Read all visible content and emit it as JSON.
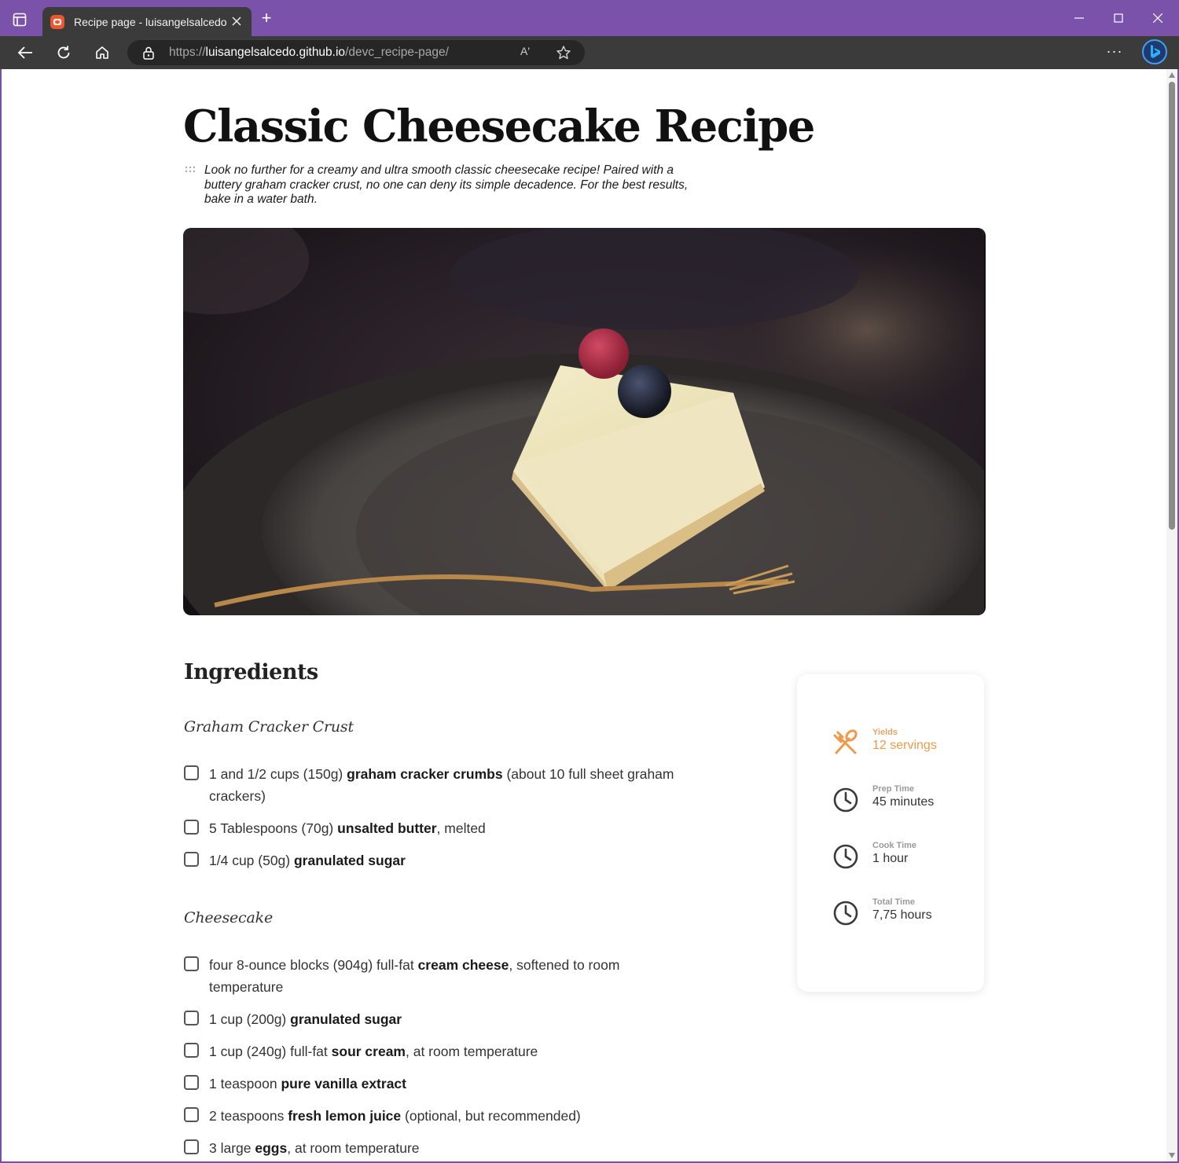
{
  "browser": {
    "tab_title": "Recipe page - luisangelsalcedo",
    "new_tab": "+",
    "url_scheme": "https://",
    "url_host": "luisangelsalcedo.github.io",
    "url_path": "/devc_recipe-page/",
    "read_aloud": "Aʹ",
    "more": "···"
  },
  "page": {
    "title": "Classic Cheesecake Recipe",
    "intro": "Look no further for a creamy and ultra smooth classic cheesecake recipe! Paired with a buttery graham cracker crust, no one can deny its simple decadence. For the best results, bake in a water bath.",
    "ingredients_heading": "Ingredients",
    "crust_heading": "Graham Cracker Crust",
    "cheesecake_heading": "Cheesecake",
    "crust_items": [
      {
        "pre": "1 and 1/2 cups (150g) ",
        "bold": "graham cracker crumbs",
        "post": " (about 10 full sheet graham crackers)"
      },
      {
        "pre": "5 Tablespoons (70g) ",
        "bold": "unsalted butter",
        "post": ", melted"
      },
      {
        "pre": "1/4 cup (50g) ",
        "bold": "granulated sugar",
        "post": ""
      }
    ],
    "cheesecake_items": [
      {
        "pre": "four 8-ounce blocks (904g) full-fat ",
        "bold": "cream cheese",
        "post": ", softened to room temperature"
      },
      {
        "pre": "1 cup (200g) ",
        "bold": "granulated sugar",
        "post": ""
      },
      {
        "pre": "1 cup (240g) full-fat ",
        "bold": "sour cream",
        "post": ", at room temperature"
      },
      {
        "pre": "1 teaspoon ",
        "bold": "pure vanilla extract",
        "post": ""
      },
      {
        "pre": "2 teaspoons ",
        "bold": "fresh lemon juice",
        "post": " (optional, but recommended)"
      },
      {
        "pre": "3 large ",
        "bold": "eggs",
        "post": ", at room temperature"
      }
    ],
    "info": {
      "yields_label": "Yields",
      "yields_value": "12 servings",
      "prep_label": "Prep Time",
      "prep_value": "45 minutes",
      "cook_label": "Cook Time",
      "cook_value": "1 hour",
      "total_label": "Total Time",
      "total_value": "7,75 hours"
    }
  },
  "colors": {
    "titlebar": "#7b52a9",
    "toolbar": "#3b3b3b",
    "accent": "#ef9a4a"
  }
}
